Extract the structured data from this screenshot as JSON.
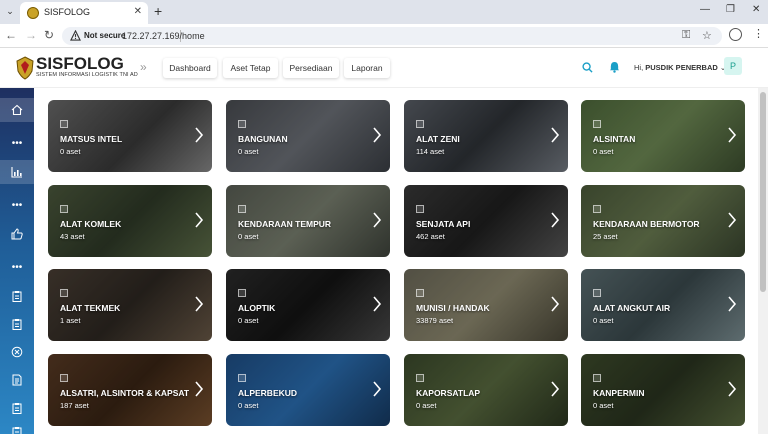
{
  "browser": {
    "tab_title": "SISFOLOG",
    "tab_close": "✕",
    "new_tab": "+",
    "not_secure": "Not secure",
    "url": "172.27.27.169/home"
  },
  "header": {
    "brand_title": "SISFOLOG",
    "brand_subtitle": "SISTEM INFORMASI LOGISTIK TNI AD",
    "nav": [
      "Dashboard",
      "Aset Tetap",
      "Persediaan",
      "Laporan"
    ],
    "greeting": "Hi,",
    "user_name": "PUSDIK PENERBAD",
    "user_caret": "⌄",
    "avatar_letter": "P"
  },
  "colors": {
    "accent": "#1a9fc7",
    "sidebar_top": "#1e2f60",
    "sidebar_bottom": "#2c87c5"
  },
  "sidebar": {
    "items": [
      {
        "icon": "home-icon"
      },
      {
        "icon": "more-dots-icon"
      },
      {
        "icon": "chart-icon"
      },
      {
        "icon": "more-dots-icon"
      },
      {
        "icon": "thumbs-up-icon"
      },
      {
        "icon": "more-dots-icon"
      },
      {
        "icon": "clipboard-icon"
      },
      {
        "icon": "clipboard-icon"
      },
      {
        "icon": "circle-x-icon"
      },
      {
        "icon": "document-icon"
      },
      {
        "icon": "clipboard-icon"
      },
      {
        "icon": "clipboard-icon"
      }
    ]
  },
  "categories": [
    {
      "title": "MATSUS INTEL",
      "count": "0 aset"
    },
    {
      "title": "BANGUNAN",
      "count": "0 aset"
    },
    {
      "title": "ALAT ZENI",
      "count": "114 aset"
    },
    {
      "title": "ALSINTAN",
      "count": "0 aset"
    },
    {
      "title": "ALAT KOMLEK",
      "count": "43 aset"
    },
    {
      "title": "KENDARAAN TEMPUR",
      "count": "0 aset"
    },
    {
      "title": "SENJATA API",
      "count": "462 aset"
    },
    {
      "title": "KENDARAAN BERMOTOR",
      "count": "25 aset"
    },
    {
      "title": "ALAT TEKMEK",
      "count": "1 aset"
    },
    {
      "title": "ALOPTIK",
      "count": "0 aset"
    },
    {
      "title": "MUNISI / HANDAK",
      "count": "33879 aset"
    },
    {
      "title": "ALAT ANGKUT AIR",
      "count": "0 aset"
    },
    {
      "title": "ALSATRI, ALSINTOR & KAPSAT",
      "count": "187 aset"
    },
    {
      "title": "ALPERBEKUD",
      "count": "0 aset"
    },
    {
      "title": "KAPORSATLAP",
      "count": "0 aset"
    },
    {
      "title": "KANPERMIN",
      "count": "0 aset"
    }
  ]
}
